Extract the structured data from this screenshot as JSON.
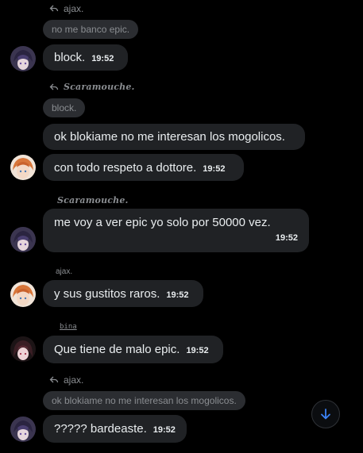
{
  "messages": [
    {
      "reply_name": "ajax.",
      "reply_text": "no me banco epic.",
      "text": "block.",
      "time": "19:52"
    },
    {
      "reply_name": "Scaramouche.",
      "reply_text": "block.",
      "text": "ok blokiame no me interesan los mogolicos."
    },
    {
      "text": "con todo respeto a dottore.",
      "time": "19:52"
    },
    {
      "name": "Scaramouche.",
      "text": "me voy a ver epic yo solo por 50000 vez.",
      "time": "19:52"
    },
    {
      "name": "ajax.",
      "text": "y sus gustitos raros.",
      "time": "19:52"
    },
    {
      "name": "bina",
      "text": "Que tiene de malo epic.",
      "time": "19:52"
    },
    {
      "reply_name": "ajax.",
      "reply_text": "ok blokiame no me interesan los mogolicos.",
      "text": "????? bardeaste.",
      "time": "19:52"
    }
  ],
  "icons": {
    "reply": "reply-arrow-icon",
    "scroll_down": "arrow-down-icon"
  },
  "colors": {
    "background": "#000000",
    "bubble": "#202225",
    "reply_bubble": "#2b2d31",
    "muted_text": "#8a8d91",
    "accent": "#3b82f6"
  }
}
